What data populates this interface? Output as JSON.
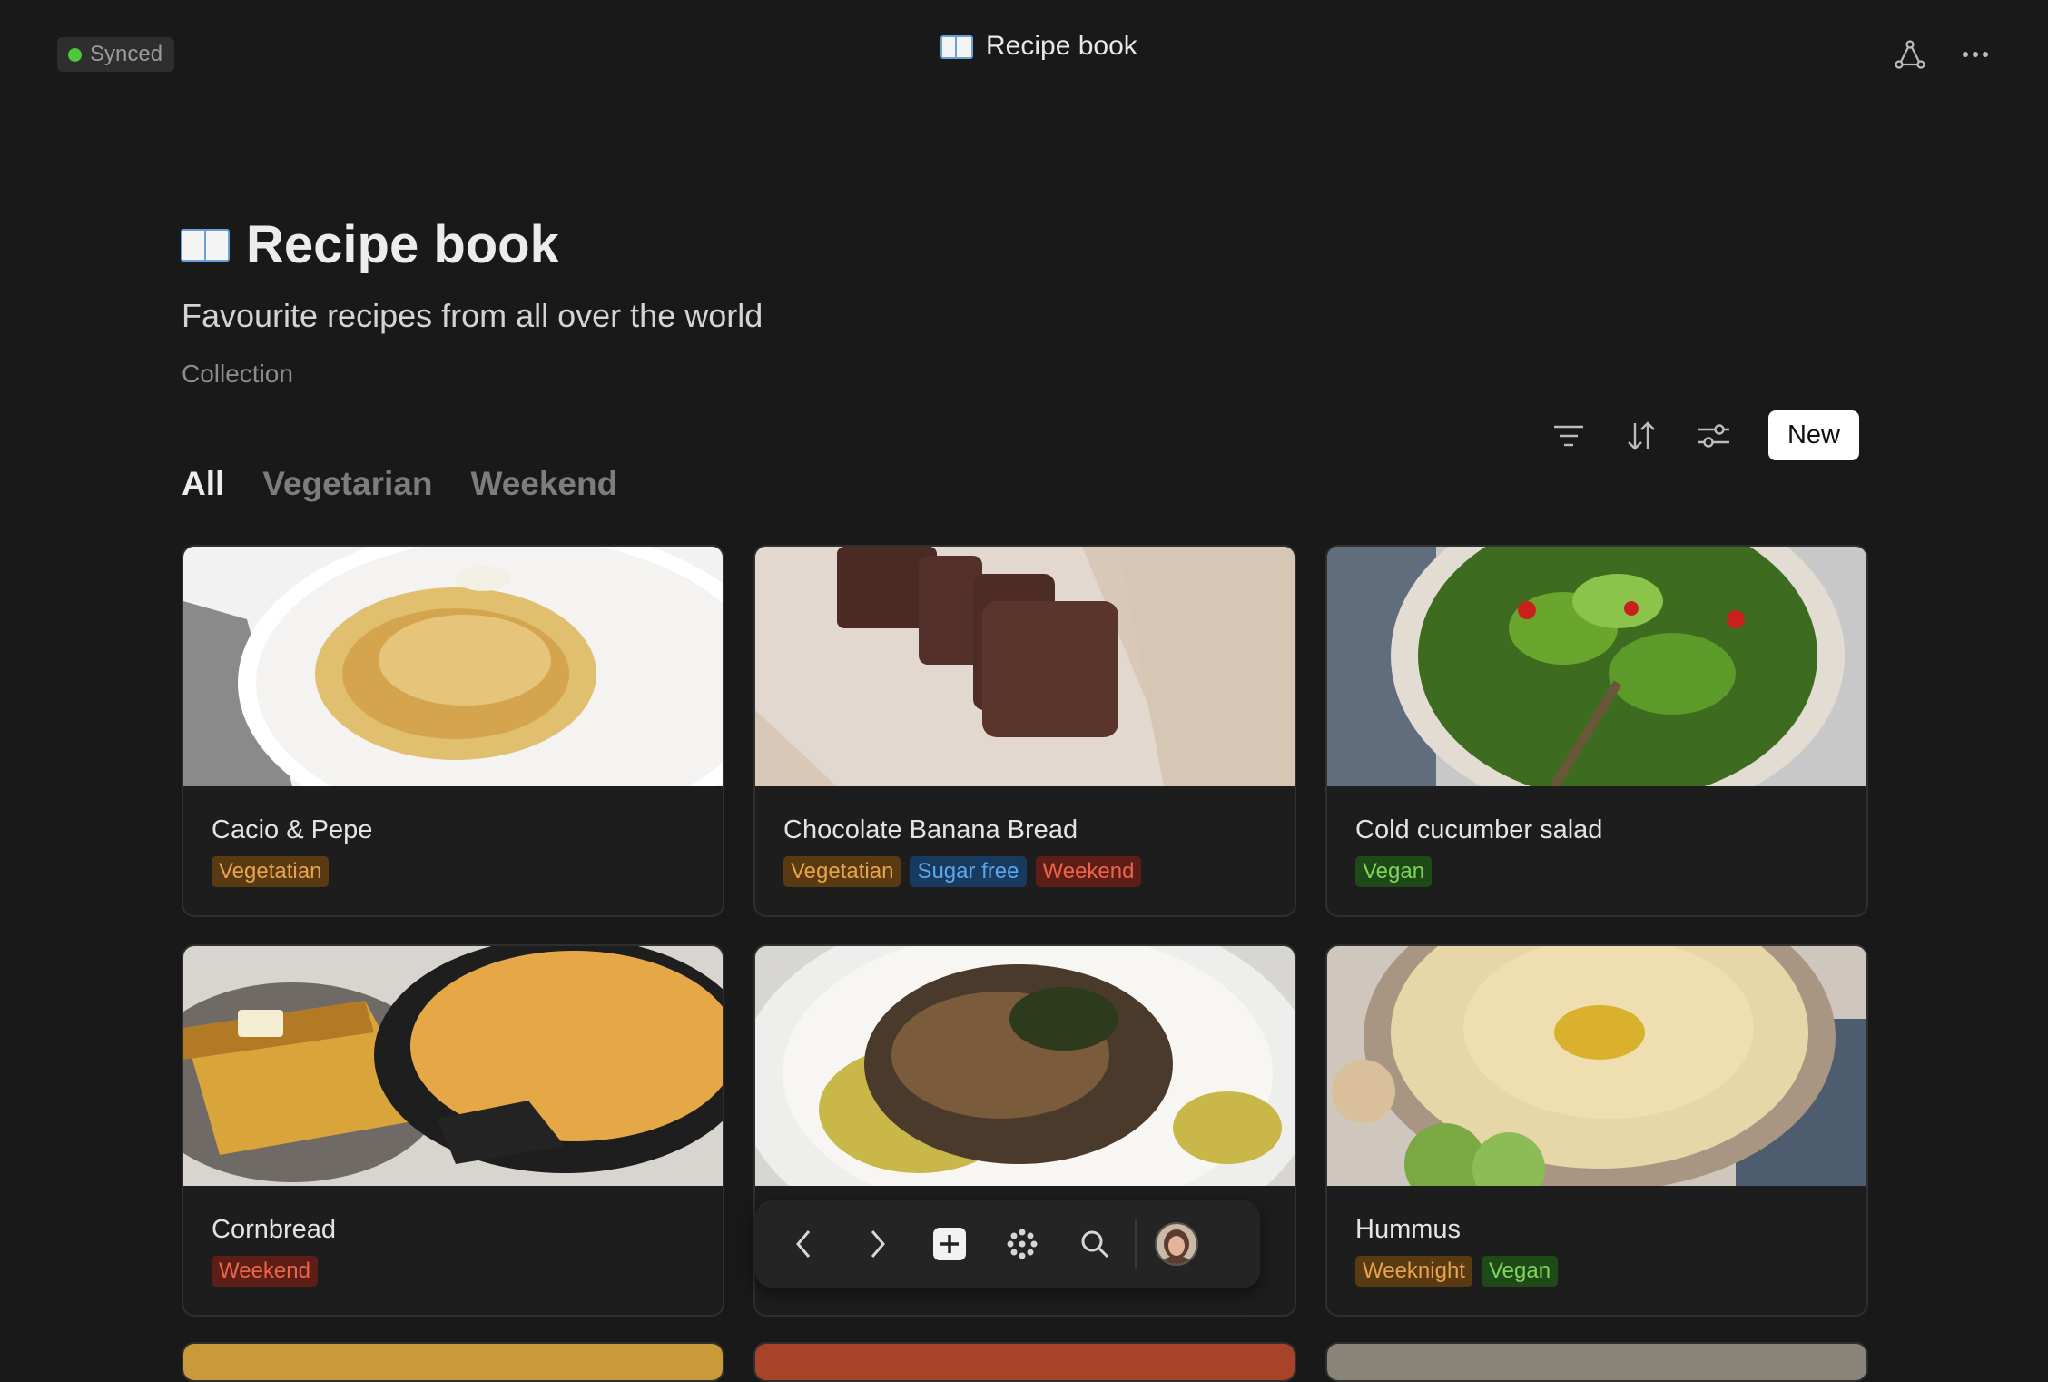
{
  "topbar": {
    "sync_status": "Synced",
    "title": "Recipe book",
    "share_icon": "share-network-icon",
    "more_icon": "more-horizontal-icon"
  },
  "page": {
    "title": "Recipe book",
    "subtitle": "Favourite recipes from all over the world",
    "kind": "Collection"
  },
  "tabs": [
    {
      "label": "All",
      "active": true
    },
    {
      "label": "Vegetarian",
      "active": false
    },
    {
      "label": "Weekend",
      "active": false
    }
  ],
  "toolbar": {
    "filter_icon": "filter-icon",
    "sort_icon": "sort-icon",
    "settings_icon": "sliders-icon",
    "new_label": "New"
  },
  "cards": [
    {
      "name": "Cacio & Pepe",
      "tags": [
        "Vegetatian"
      ]
    },
    {
      "name": "Chocolate Banana Bread",
      "tags": [
        "Vegetatian",
        "Sugar free",
        "Weekend"
      ]
    },
    {
      "name": "Cold cucumber salad",
      "tags": [
        "Vegan"
      ]
    },
    {
      "name": "Cornbread",
      "tags": [
        "Weekend"
      ]
    },
    {
      "name": "",
      "tags": []
    },
    {
      "name": "Hummus",
      "tags": [
        "Weeknight",
        "Vegan"
      ]
    }
  ],
  "bottom_bar": {
    "items": [
      "back-icon",
      "forward-icon",
      "add-icon",
      "apps-icon",
      "search-icon",
      "avatar"
    ]
  },
  "colors": {
    "background": "#191919",
    "tag_vegetarian": "#e8a44a",
    "tag_sugar_free": "#5aa8ec",
    "tag_weekend": "#ee6448",
    "tag_vegan": "#7fd65a",
    "synced_dot": "#4bc93a"
  }
}
